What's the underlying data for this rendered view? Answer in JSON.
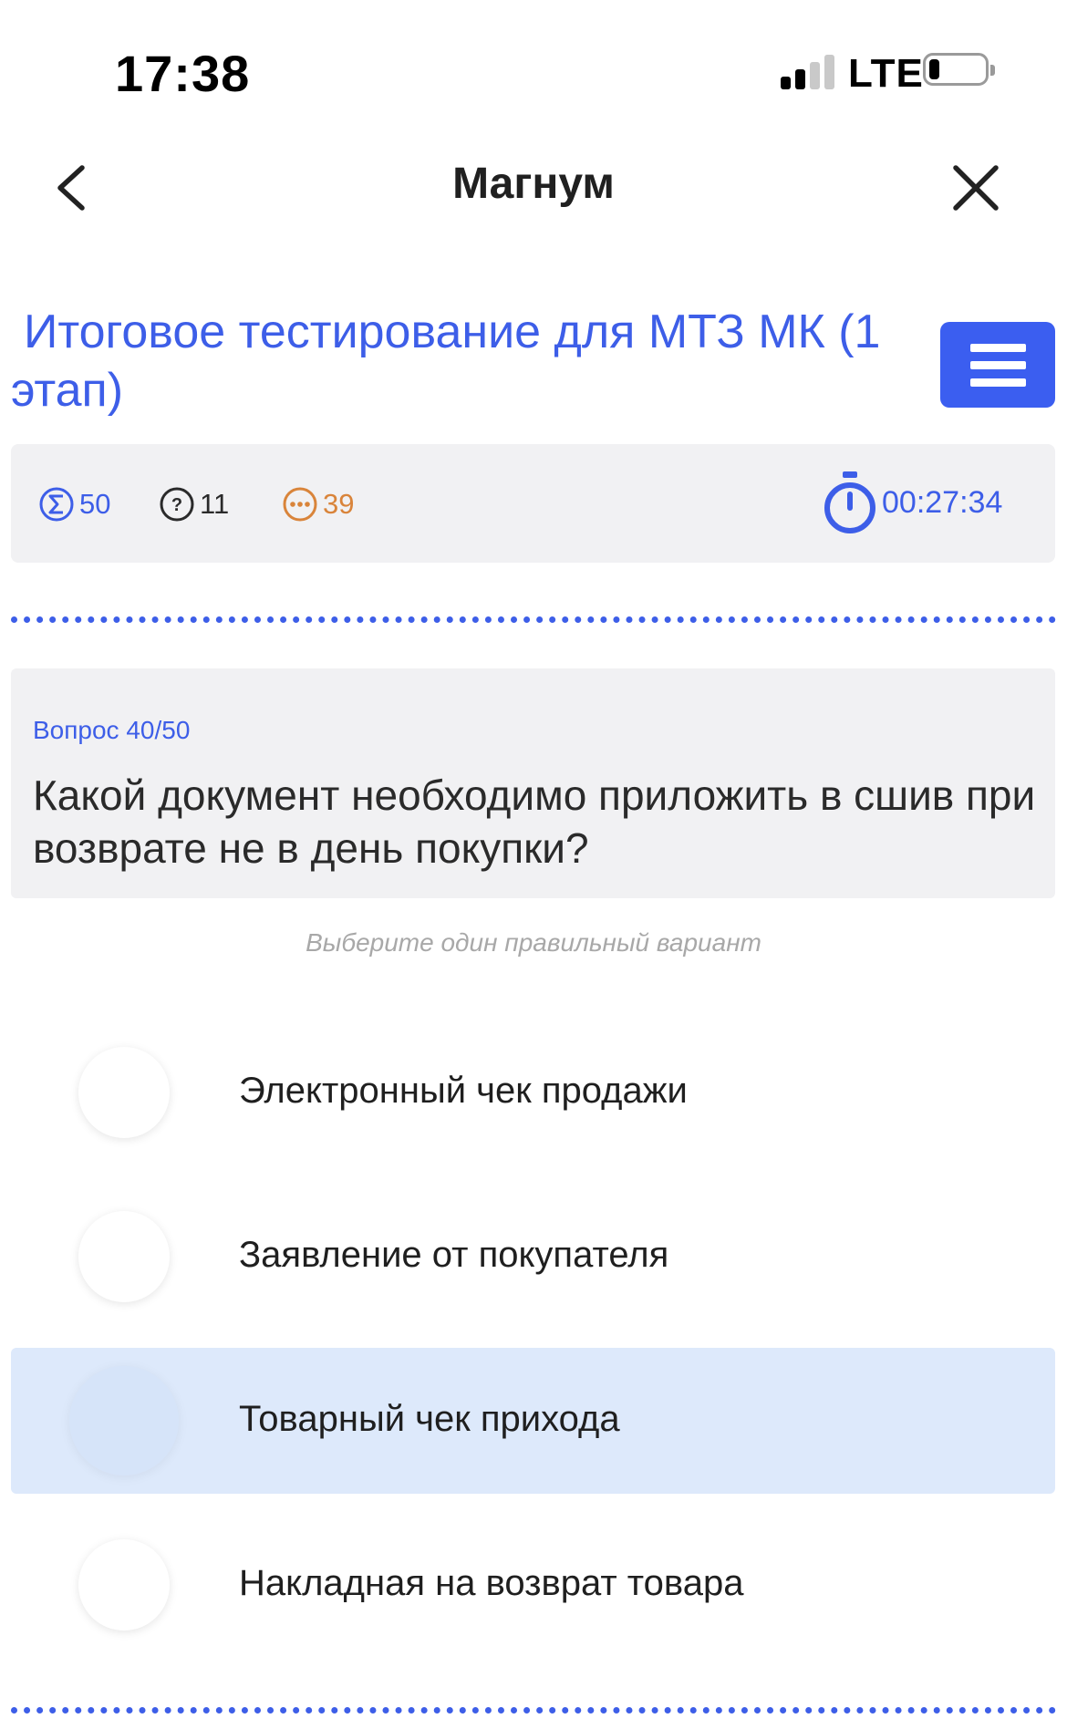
{
  "status_bar": {
    "time": "17:38",
    "network": "LTE"
  },
  "nav": {
    "title": "Магнум",
    "back_icon": "chevron-left-icon",
    "close_icon": "close-icon"
  },
  "test": {
    "title": "Итоговое тестирование для МТЗ МК (1 этап)",
    "menu_icon": "hamburger-menu-icon"
  },
  "stats": {
    "total": "50",
    "unanswered": "11",
    "remaining": "39",
    "timer": "00:27:34"
  },
  "question": {
    "number": "Вопрос 40/50",
    "text": "Какой документ необходимо приложить в сшив при возврате не в день покупки?",
    "hint": "Выберите один правильный вариант"
  },
  "options": [
    {
      "label": "Электронный чек продажи",
      "selected": false
    },
    {
      "label": "Заявление от покупателя",
      "selected": false
    },
    {
      "label": "Товарный чек прихода",
      "selected": true
    },
    {
      "label": "Накладная на возврат товара",
      "selected": false
    }
  ],
  "colors": {
    "accent": "#3d5ee8",
    "menu_button": "#3b5ef0",
    "remaining": "#d9843a",
    "panel_bg": "#f1f1f3",
    "selected_bg": "#dde9fb"
  }
}
